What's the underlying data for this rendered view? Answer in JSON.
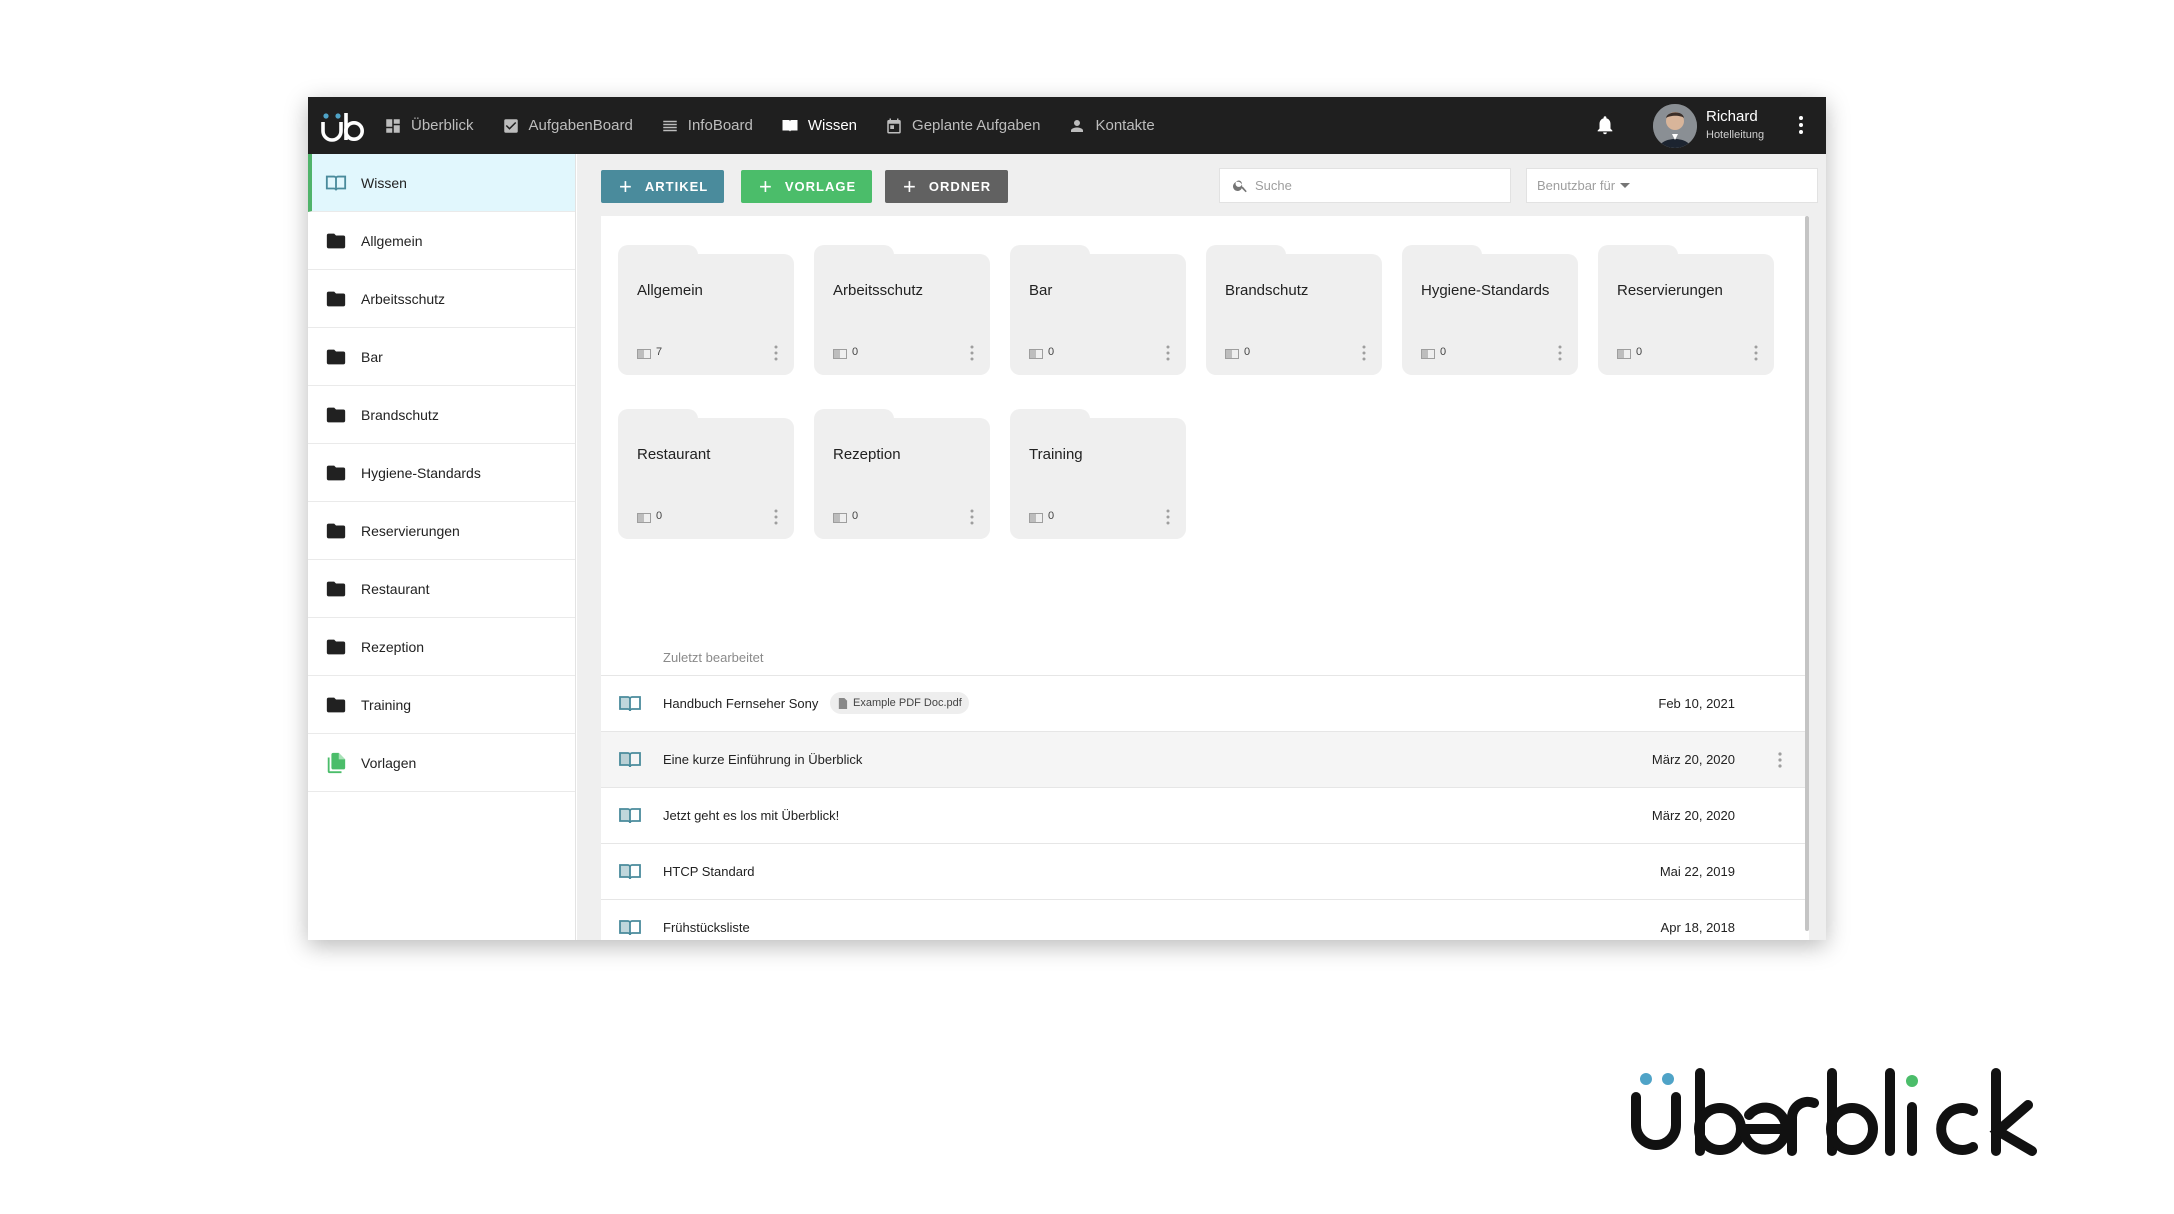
{
  "nav": {
    "items": [
      {
        "label": "Überblick",
        "icon": "dashboard-icon"
      },
      {
        "label": "AufgabenBoard",
        "icon": "checkbox-icon"
      },
      {
        "label": "InfoBoard",
        "icon": "list-icon"
      },
      {
        "label": "Wissen",
        "icon": "book-icon"
      },
      {
        "label": "Geplante Aufgaben",
        "icon": "calendar-icon"
      },
      {
        "label": "Kontakte",
        "icon": "person-icon"
      }
    ],
    "active": "Wissen"
  },
  "user": {
    "name": "Richard",
    "role": "Hotelleitung"
  },
  "sidebar": {
    "items": [
      {
        "label": "Wissen",
        "icon": "book-icon"
      },
      {
        "label": "Allgemein",
        "icon": "folder-icon"
      },
      {
        "label": "Arbeitsschutz",
        "icon": "folder-icon"
      },
      {
        "label": "Bar",
        "icon": "folder-icon"
      },
      {
        "label": "Brandschutz",
        "icon": "folder-icon"
      },
      {
        "label": "Hygiene-Standards",
        "icon": "folder-icon"
      },
      {
        "label": "Reservierungen",
        "icon": "folder-icon"
      },
      {
        "label": "Restaurant",
        "icon": "folder-icon"
      },
      {
        "label": "Rezeption",
        "icon": "folder-icon"
      },
      {
        "label": "Training",
        "icon": "folder-icon"
      },
      {
        "label": "Vorlagen",
        "icon": "templates-icon"
      }
    ]
  },
  "toolbar": {
    "artikel_label": "ARTIKEL",
    "vorlage_label": "VORLAGE",
    "ordner_label": "ORDNER",
    "search_placeholder": "Suche",
    "usable_label": "Benutzbar für"
  },
  "folders": [
    {
      "name": "Allgemein",
      "count": "7"
    },
    {
      "name": "Arbeitsschutz",
      "count": "0"
    },
    {
      "name": "Bar",
      "count": "0"
    },
    {
      "name": "Brandschutz",
      "count": "0"
    },
    {
      "name": "Hygiene-Standards",
      "count": "0"
    },
    {
      "name": "Reservierungen",
      "count": "0"
    },
    {
      "name": "Restaurant",
      "count": "0"
    },
    {
      "name": "Rezeption",
      "count": "0"
    },
    {
      "name": "Training",
      "count": "0"
    }
  ],
  "recent": {
    "title": "Zuletzt bearbeitet",
    "items": [
      {
        "title": "Handbuch Fernseher Sony",
        "attachment": "Example PDF Doc.pdf",
        "date": "Feb 10, 2021"
      },
      {
        "title": "Eine kurze Einführung in Überblick",
        "date": "März 20, 2020"
      },
      {
        "title": "Jetzt geht es los mit Überblick!",
        "date": "März 20, 2020"
      },
      {
        "title": "HTCP Standard",
        "date": "Mai 22, 2019"
      },
      {
        "title": "Frühstücksliste",
        "date": "Apr 18, 2018"
      }
    ]
  },
  "brand": {
    "wordmark": "überblick"
  },
  "colors": {
    "topbar": "#1f1f1f",
    "active_sidebar_bg": "#e1f7fd",
    "accent_green": "#4bbd6a",
    "artikel_blue": "#4a8b9c",
    "ordner_gray": "#616161",
    "book_teal": "#4a8b9c"
  }
}
